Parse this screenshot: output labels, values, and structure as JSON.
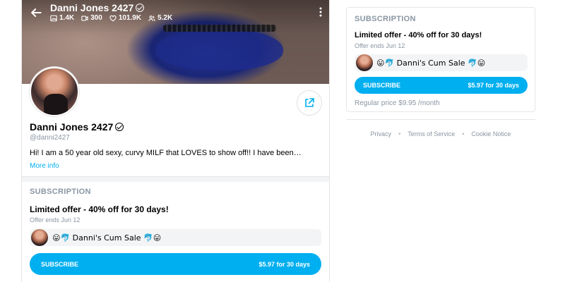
{
  "header": {
    "name": "Danni Jones 2427",
    "stats": [
      {
        "icon": "image-icon",
        "value": "1.4K"
      },
      {
        "icon": "video-icon",
        "value": "300"
      },
      {
        "icon": "heart-icon",
        "value": "101.9K"
      },
      {
        "icon": "users-icon",
        "value": "5.2K"
      }
    ]
  },
  "profile": {
    "name": "Danni Jones 2427",
    "handle": "@danni2427",
    "bio": "Hi! I am a 50 year old sexy, curvy MILF that LOVES to show off!! I have been…",
    "more_info": "More info"
  },
  "subscription": {
    "title": "SUBSCRIPTION",
    "offer": "Limited offer - 40% off for 30 days!",
    "offer_ends": "Offer ends Jun 12",
    "promo_text": "😛🐬 Danni's Cum Sale 🐬😛",
    "subscribe_label": "SUBSCRIBE",
    "subscribe_price": "$5.97 for 30 days"
  },
  "sidebar": {
    "title": "SUBSCRIPTION",
    "offer": "Limited offer - 40% off for 30 days!",
    "offer_ends": "Offer ends Jun 12",
    "promo_text": "😛🐬 Danni's Cum Sale 🐬😛",
    "subscribe_label": "SUBSCRIBE",
    "subscribe_price": "$5.97 for 30 days",
    "regular_price": "Regular price $9.95 /month"
  },
  "footer": {
    "links": [
      "Privacy",
      "Terms of Service",
      "Cookie Notice"
    ]
  },
  "colors": {
    "accent": "#00aff0",
    "muted": "#8a96a3",
    "panel": "#f2f4f5"
  }
}
